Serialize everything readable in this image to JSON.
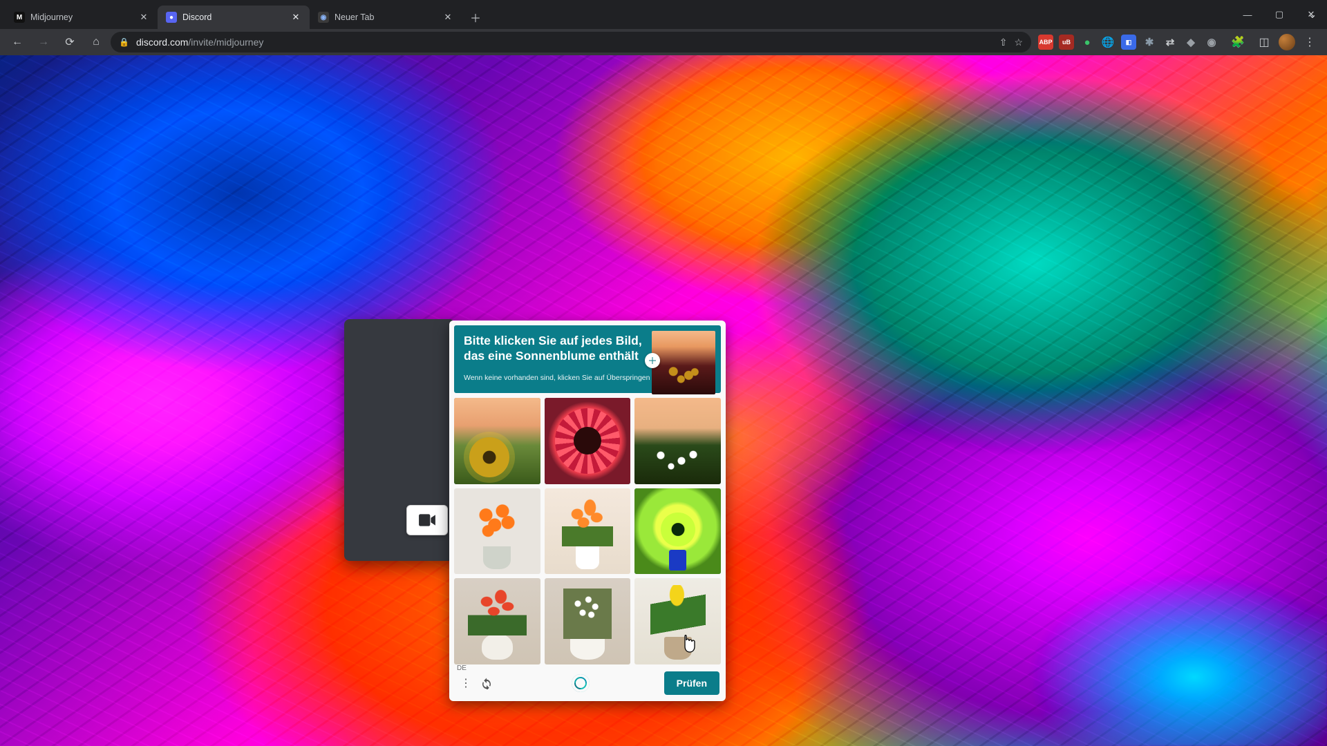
{
  "browser": {
    "tabs": [
      {
        "title": "Midjourney",
        "favicon_bg": "#111",
        "favicon_fg": "#fff",
        "favicon_letter": "M",
        "active": false
      },
      {
        "title": "Discord",
        "favicon_bg": "#5865f2",
        "favicon_fg": "#fff",
        "favicon_letter": "●",
        "active": true
      },
      {
        "title": "Neuer Tab",
        "favicon_bg": "#3a3a3a",
        "favicon_fg": "#8ab4f8",
        "favicon_letter": "◉",
        "active": false
      }
    ],
    "url": {
      "host": "discord.com",
      "path": "/invite/midjourney"
    },
    "extensions": [
      {
        "name": "abp-extension",
        "label": "ABP",
        "bg": "#d8392f"
      },
      {
        "name": "ublock-extension",
        "label": "uB",
        "bg": "#a52a22"
      },
      {
        "name": "ext-green-dot",
        "label": "●",
        "bg": "transparent",
        "fg": "#3ac46a"
      },
      {
        "name": "globe-extension-icon",
        "label": "🌐",
        "bg": "transparent"
      },
      {
        "name": "wallet-extension-icon",
        "label": "◧",
        "bg": "#3a6ae8"
      },
      {
        "name": "flower-extension-icon",
        "label": "✱",
        "bg": "transparent",
        "fg": "#8a9aa8"
      },
      {
        "name": "translate-extension-icon",
        "label": "⇄",
        "bg": "transparent"
      },
      {
        "name": "shield-extension-icon",
        "label": "◆",
        "bg": "transparent",
        "fg": "#9aa0a6"
      },
      {
        "name": "camera-extension-icon",
        "label": "◉",
        "bg": "transparent",
        "fg": "#9aa0a6"
      }
    ]
  },
  "captcha": {
    "line1": "Bitte klicken Sie auf jedes Bild,",
    "line2": "das eine Sonnenblume enthält",
    "hint": "Wenn keine vorhanden sind, klicken Sie auf Überspringen",
    "language": "DE",
    "verify_label": "Prüfen",
    "tiles": [
      {
        "name": "tile-1",
        "selected": true,
        "thumb": "t1"
      },
      {
        "name": "tile-2",
        "selected": true,
        "thumb": "t2"
      },
      {
        "name": "tile-3",
        "selected": false,
        "thumb": "t3"
      },
      {
        "name": "tile-4",
        "selected": false,
        "thumb": "t4"
      },
      {
        "name": "tile-5",
        "selected": false,
        "thumb": "t5"
      },
      {
        "name": "tile-6",
        "selected": true,
        "thumb": "t6"
      },
      {
        "name": "tile-7",
        "selected": false,
        "thumb": "t7"
      },
      {
        "name": "tile-8",
        "selected": false,
        "thumb": "t8"
      },
      {
        "name": "tile-9",
        "selected": false,
        "thumb": "t9"
      }
    ]
  }
}
